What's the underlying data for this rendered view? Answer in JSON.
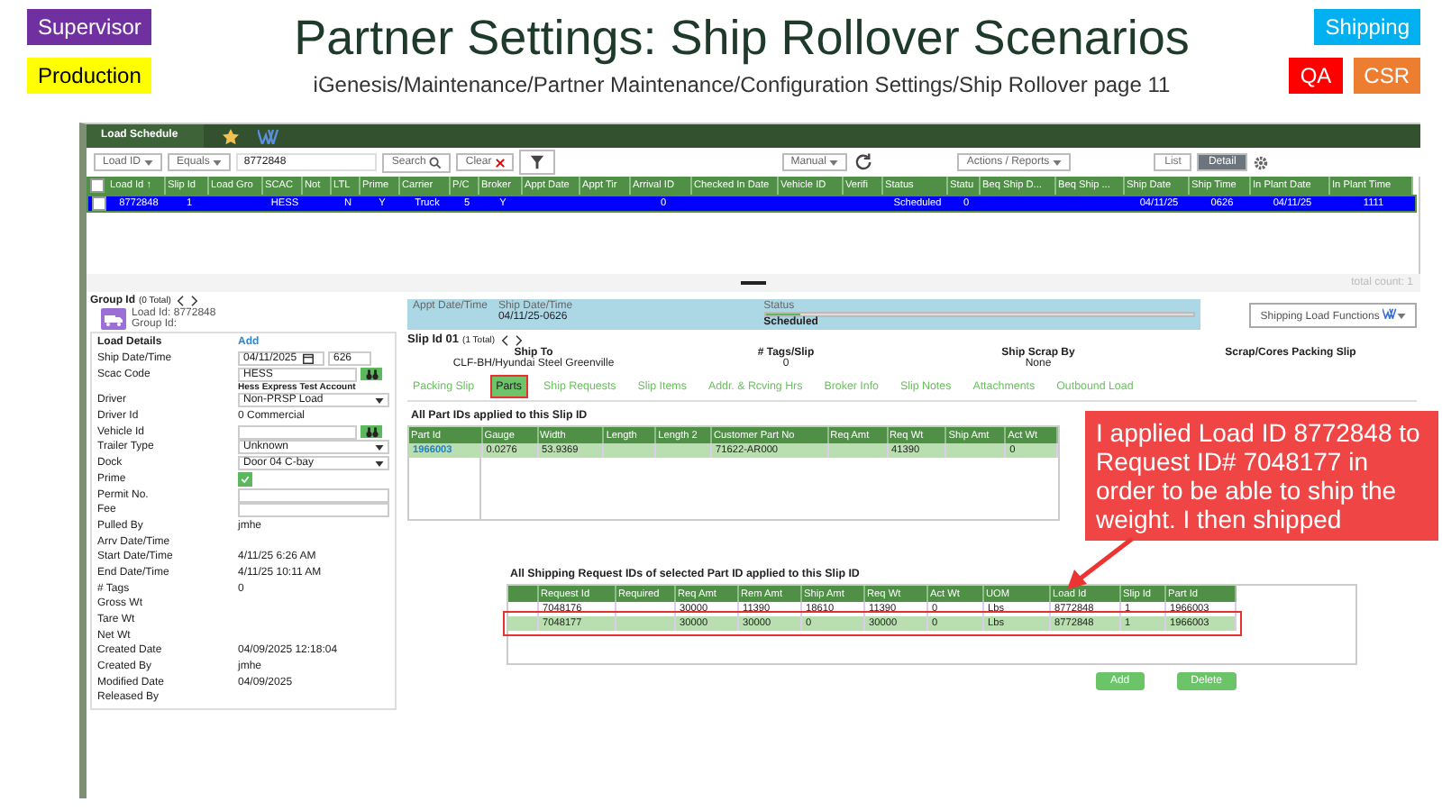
{
  "slide": {
    "title": "Partner Settings: Ship Rollover Scenarios",
    "subtitle": "iGenesis/Maintenance/Partner Maintenance/Configuration Settings/Ship Rollover page 11",
    "left_badges": [
      {
        "label": "Supervisor",
        "color": "#7030a0"
      },
      {
        "label": "Production",
        "color": "#ffff00"
      }
    ],
    "right_badges": [
      {
        "label": "Shipping",
        "color": "#00b0f0"
      },
      {
        "label": "QA",
        "color": "#ff0000"
      },
      {
        "label": "CSR",
        "color": "#ed7d31"
      }
    ]
  },
  "app": {
    "title": "Load Schedule",
    "toolbar": {
      "field_filter": "Load ID",
      "operator": "Equals",
      "search_value": "8772848",
      "search_button": "Search",
      "clear_button": "Clear",
      "mode": "Manual",
      "actions": "Actions / Reports",
      "view_toggle": [
        {
          "label": "List",
          "selected": false
        },
        {
          "label": "Detail",
          "selected": true
        }
      ]
    },
    "grid": {
      "columns": [
        "Load Id ↑",
        "Slip Id",
        "Load Gro",
        "SCAC",
        "Not",
        "LTL",
        "Prime",
        "Carrier",
        "P/C",
        "Broker",
        "Appt Date",
        "Appt Tir",
        "Arrival ID",
        "Checked In Date",
        "Vehicle ID",
        "Verifi",
        "Status",
        "Statu",
        "Beq Ship D...",
        "Beq Ship ...",
        "Ship Date",
        "Ship Time",
        "In Plant Date",
        "In Plant Time"
      ],
      "all_checked": false,
      "rows": [
        {
          "selected": true,
          "checked": false,
          "cells": [
            "8772848",
            "1",
            "",
            "HESS",
            "",
            "N",
            "Y",
            "Truck",
            "5",
            "Y",
            "",
            "",
            "0",
            "",
            "",
            "",
            "Scheduled",
            "0",
            "",
            "",
            "04/11/25",
            "0626",
            "04/11/25",
            "1111"
          ]
        }
      ]
    },
    "total_count": "total count: 1",
    "group": {
      "title": "Group Id",
      "total": "(0 Total)",
      "load_id": "Load Id: 8772848",
      "group_id": "Group Id:"
    },
    "load_details": {
      "title": "Load Details",
      "add": "Add",
      "fields": [
        {
          "kind": "date",
          "label": "Ship Date/Time",
          "value": "04/11/2025",
          "value2": "626"
        },
        {
          "kind": "lookup",
          "label": "Scac Code",
          "value": "HESS",
          "note": "Hess Express Test Account"
        },
        {
          "kind": "select",
          "label": "Driver",
          "value": "Non-PRSP Load"
        },
        {
          "kind": "text",
          "label": "Driver Id",
          "value": "0 Commercial"
        },
        {
          "kind": "lookup",
          "label": "Vehicle Id"
        },
        {
          "kind": "select",
          "label": "Trailer Type",
          "value": "Unknown"
        },
        {
          "kind": "select",
          "label": "Dock",
          "value": "Door 04 C-bay"
        },
        {
          "kind": "checkbox",
          "label": "Prime",
          "checked": true
        },
        {
          "kind": "input",
          "label": "Permit No."
        },
        {
          "kind": "input",
          "label": "Fee"
        },
        {
          "kind": "text",
          "label": "Pulled By",
          "value": "jmhe"
        },
        {
          "kind": "text",
          "label": "Arrv Date/Time"
        },
        {
          "kind": "text",
          "label": "Start Date/Time",
          "value": "4/11/25 6:26 AM"
        },
        {
          "kind": "text",
          "label": "End Date/Time",
          "value": "4/11/25 10:11 AM"
        },
        {
          "kind": "text",
          "label": "# Tags",
          "value": "0"
        },
        {
          "kind": "text",
          "label": "Gross Wt"
        },
        {
          "kind": "text",
          "label": "Tare Wt"
        },
        {
          "kind": "text",
          "label": "Net Wt"
        },
        {
          "kind": "text",
          "label": "Created Date",
          "value": "04/09/2025 12:18:04"
        },
        {
          "kind": "text",
          "label": "Created By",
          "value": "jmhe"
        },
        {
          "kind": "text",
          "label": "Modified Date",
          "value": "04/09/2025"
        },
        {
          "kind": "text",
          "label": "Released By"
        }
      ]
    },
    "status_band": {
      "appt_label": "Appt Date/Time",
      "ship_label": "Ship Date/Time",
      "ship_value": "04/11/25-0626",
      "status_label": "Status",
      "status_value": "Scheduled",
      "level": 0.08
    },
    "functions_button": "Shipping Load Functions",
    "slip": {
      "title": "Slip Id 01",
      "total": "(1 Total)",
      "info": [
        {
          "label": "Ship To",
          "value": "CLF-BH/Hyundai Steel Greenville"
        },
        {
          "label": "# Tags/Slip",
          "value": "0"
        },
        {
          "label": "Ship Scrap By",
          "value": "None"
        },
        {
          "label": "Scrap/Cores Packing Slip"
        }
      ],
      "tabs": [
        {
          "label": "Packing Slip",
          "selected": false,
          "highlighted": false
        },
        {
          "label": "Parts",
          "selected": true,
          "highlighted": true
        },
        {
          "label": "Ship Requests",
          "selected": false,
          "highlighted": false
        },
        {
          "label": "Slip Items",
          "selected": false,
          "highlighted": false
        },
        {
          "label": "Addr. & Rcving Hrs",
          "selected": false,
          "highlighted": false
        },
        {
          "label": "Broker Info",
          "selected": false,
          "highlighted": false
        },
        {
          "label": "Slip Notes",
          "selected": false,
          "highlighted": false
        },
        {
          "label": "Attachments",
          "selected": false,
          "highlighted": false
        },
        {
          "label": "Outbound Load",
          "selected": false,
          "highlighted": false
        }
      ]
    },
    "parts": {
      "title": "All Part IDs applied to this Slip ID",
      "columns": [
        "Part Id",
        "Gauge",
        "Width",
        "Length",
        "Length 2",
        "Customer Part No",
        "Req Amt",
        "Req Wt",
        "Ship Amt",
        "Act Wt"
      ],
      "rows": [
        {
          "selected": true,
          "cells": [
            "1966003",
            "0.0276",
            "53.9369",
            "",
            "",
            "71622-AR000",
            "",
            "41390",
            "",
            "0"
          ]
        }
      ]
    },
    "requests": {
      "title": "All Shipping Request IDs of selected Part ID applied to this Slip ID",
      "columns": [
        "Request Id",
        "Required",
        "Req Amt",
        "Rem Amt",
        "Ship Amt",
        "Req Wt",
        "Act Wt",
        "UOM",
        "Load Id",
        "Slip Id",
        "Part Id"
      ],
      "rows": [
        {
          "selected": false,
          "highlighted": false,
          "cells": [
            "7048176",
            "",
            "30000",
            "11390",
            "18610",
            "11390",
            "0",
            "Lbs",
            "8772848",
            "1",
            "1966003"
          ]
        },
        {
          "selected": true,
          "highlighted": true,
          "cells": [
            "7048177",
            "",
            "30000",
            "30000",
            "0",
            "30000",
            "0",
            "Lbs",
            "8772848",
            "1",
            "1966003"
          ]
        }
      ],
      "buttons": [
        "Add",
        "Delete"
      ]
    },
    "callout": "I applied Load ID 8772848 to Request ID# 7048177 in order to be able to ship the weight. I then shipped"
  }
}
